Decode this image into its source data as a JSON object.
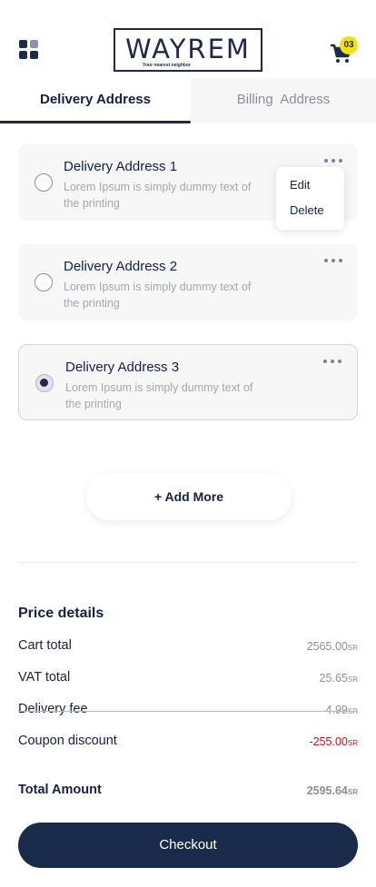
{
  "header": {
    "logo_text": "WAYREM",
    "logo_tagline": "Your nearest neighbor",
    "cart_count": "03"
  },
  "tabs": {
    "delivery": "Delivery Address",
    "billing": "Billing  Address"
  },
  "addresses": [
    {
      "title": "Delivery Address 1",
      "desc": "Lorem Ipsum is simply dummy text of the printing",
      "selected": false
    },
    {
      "title": "Delivery Address 2",
      "desc": "Lorem Ipsum is simply dummy text of the printing",
      "selected": false
    },
    {
      "title": "Delivery Address 3",
      "desc": "Lorem Ipsum is simply dummy text of the printing",
      "selected": true
    }
  ],
  "context_menu": {
    "edit": "Edit",
    "delete": "Delete"
  },
  "add_more_label": "+ Add More",
  "price": {
    "title": "Price details",
    "currency": "SR",
    "rows": [
      {
        "label": "Cart total",
        "value": "2565.00"
      },
      {
        "label": "VAT total",
        "value": "25.65"
      },
      {
        "label": "Delivery fee",
        "value": "4.99"
      },
      {
        "label": "Coupon discount",
        "value": "-255.00"
      }
    ],
    "total_label": "Total Amount",
    "total_value": "2595.64"
  },
  "checkout_label": "Checkout",
  "colors": {
    "primary": "#1a2a4a",
    "badge": "#f2e20c",
    "discount": "#c1121f"
  }
}
